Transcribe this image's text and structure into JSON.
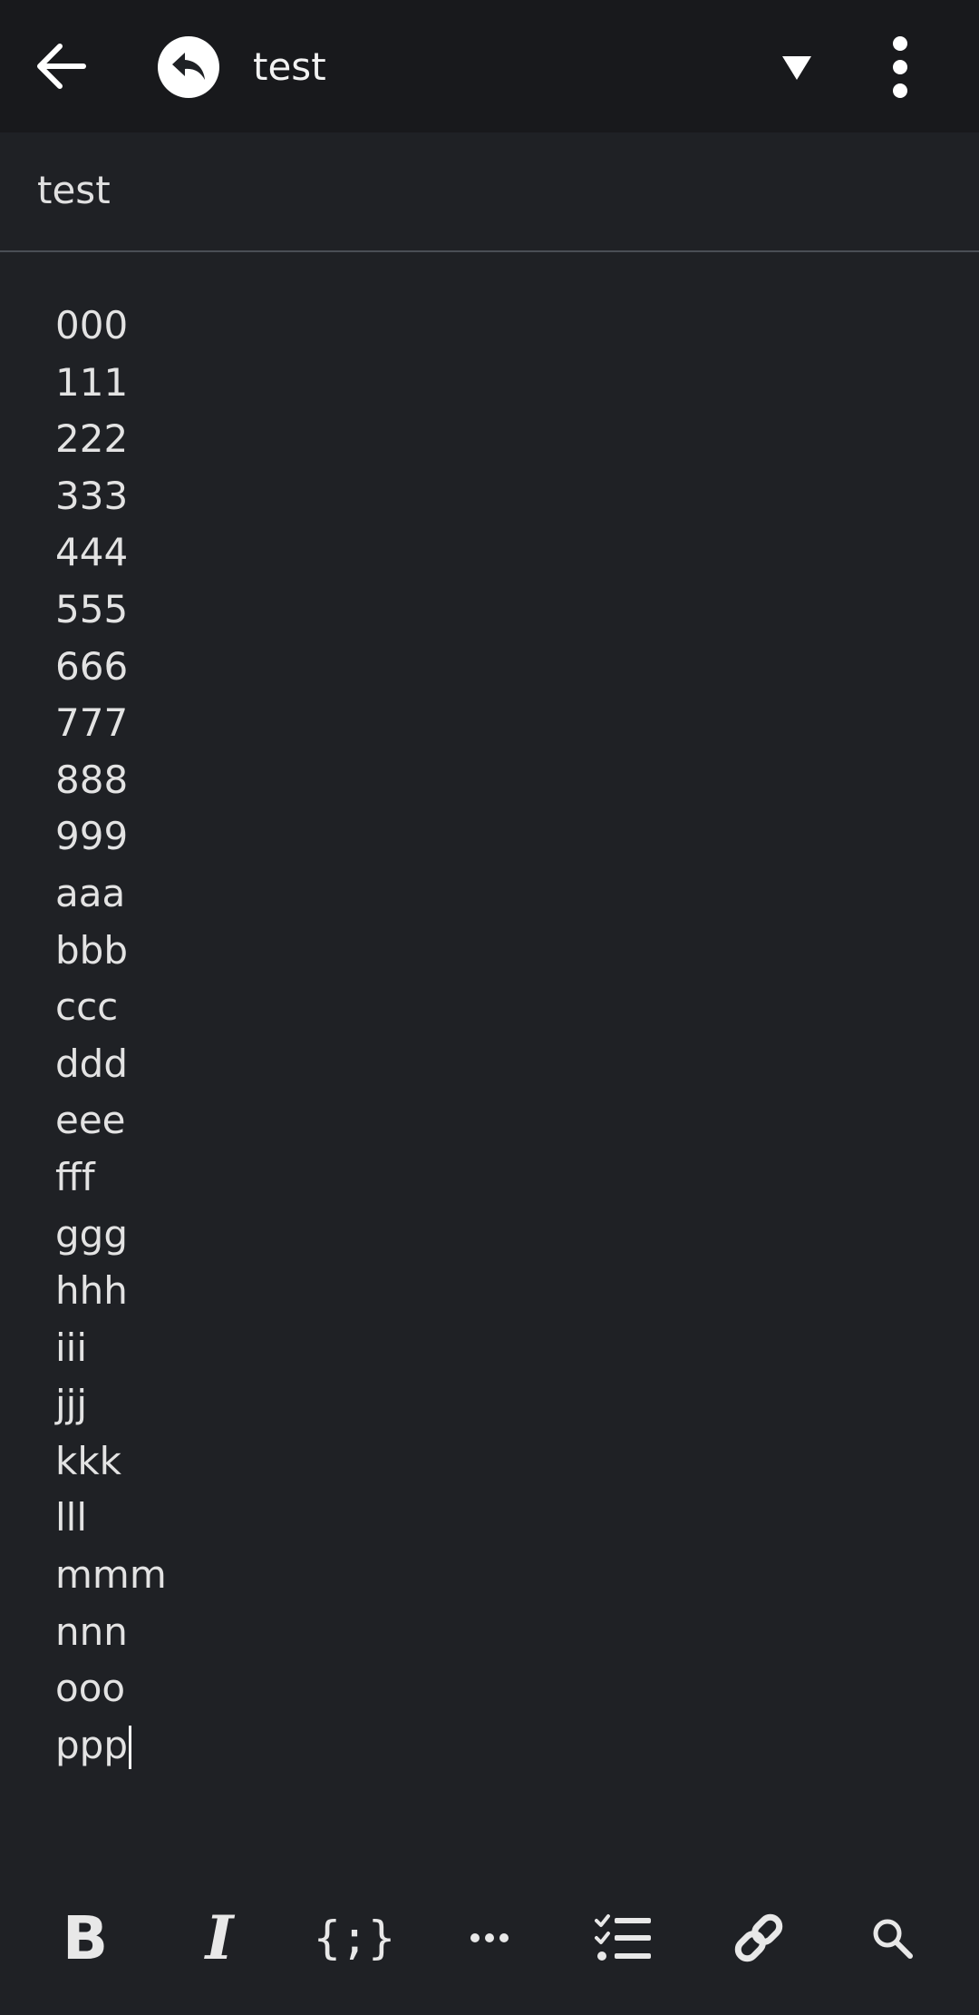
{
  "appbar": {
    "title": "test",
    "icons": {
      "back": "arrow-back-icon",
      "app": "reply-arrow-icon",
      "dropdown": "triangle-down-icon",
      "overflow": "more-vert-icon"
    }
  },
  "note": {
    "title": "test",
    "lines": [
      "000",
      "111",
      "222",
      "333",
      "444",
      "555",
      "666",
      "777",
      "888",
      "999",
      "aaa",
      "bbb",
      "ccc",
      "ddd",
      "eee",
      "fff",
      "ggg",
      "hhh",
      "iii",
      "jjj",
      "kkk",
      "lll",
      "mmm",
      "nnn",
      "ooo",
      "ppp"
    ]
  },
  "toolbar": {
    "bold_label": "B",
    "italic_label": "I",
    "code_label": "{;}",
    "icons": {
      "more": "more-horiz-icon",
      "checklist": "checklist-icon",
      "link": "link-icon",
      "search": "search-icon"
    }
  },
  "colors": {
    "background": "#1f2125",
    "appbar": "#18191c",
    "text": "#e3e3e3",
    "divider": "#4a4e55"
  }
}
